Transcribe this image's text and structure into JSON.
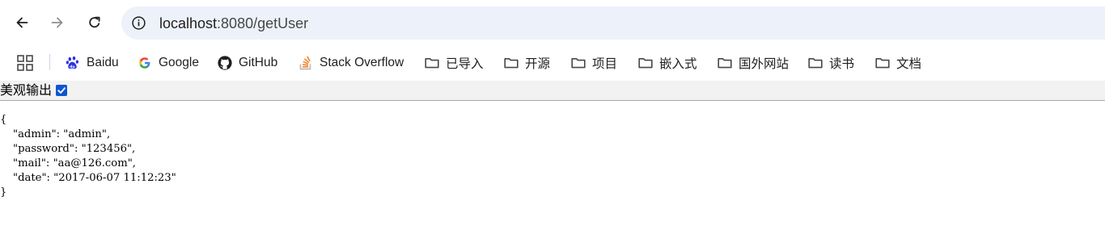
{
  "browser": {
    "url_host": "localhost",
    "url_rest": ":8080/getUser",
    "icons": {
      "back": "arrow-left-icon",
      "forward": "arrow-right-icon",
      "reload": "reload-icon",
      "site_info": "info-icon",
      "apps": "apps-grid-icon"
    }
  },
  "bookmarks": [
    {
      "label": "Baidu",
      "icon": "baidu-paw-icon"
    },
    {
      "label": "Google",
      "icon": "google-g-icon"
    },
    {
      "label": "GitHub",
      "icon": "github-icon"
    },
    {
      "label": "Stack Overflow",
      "icon": "stackoverflow-icon"
    },
    {
      "label": "已导入",
      "icon": "folder-icon"
    },
    {
      "label": "开源",
      "icon": "folder-icon"
    },
    {
      "label": "项目",
      "icon": "folder-icon"
    },
    {
      "label": "嵌入式",
      "icon": "folder-icon"
    },
    {
      "label": "国外网站",
      "icon": "folder-icon"
    },
    {
      "label": "读书",
      "icon": "folder-icon"
    },
    {
      "label": "文档",
      "icon": "folder-icon"
    }
  ],
  "page": {
    "pretty_label": "美观输出",
    "pretty_checked": true,
    "json_open": "{",
    "json_lines": [
      "\"admin\": \"admin\",",
      "\"password\": \"123456\",",
      "\"mail\": \"aa@126.com\",",
      "\"date\": \"2017-06-07 11:12:23\""
    ],
    "json_close": "}"
  },
  "colors": {
    "omnibox_bg": "#edf2fa",
    "checkbox": "#0b57d0",
    "pretty_bar_bg": "#f2f2f2"
  }
}
